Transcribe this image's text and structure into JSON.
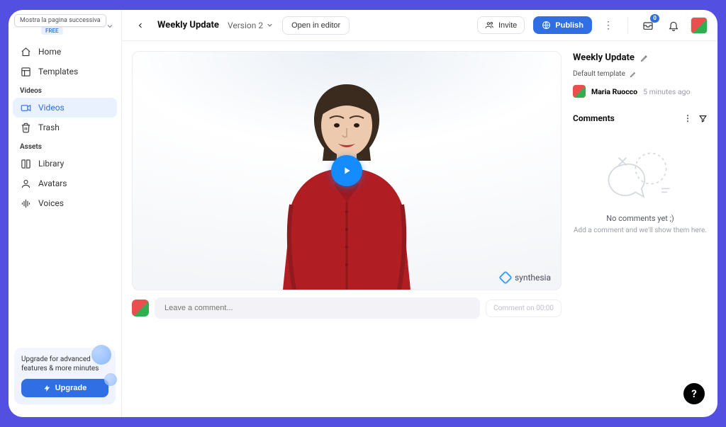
{
  "tooltip": "Mostra la pagina successiva",
  "plan_badge": "FREE",
  "sidebar": {
    "nav": [
      {
        "label": "Home"
      },
      {
        "label": "Templates"
      }
    ],
    "sections": [
      {
        "title": "Videos",
        "items": [
          {
            "label": "Videos",
            "active": true
          },
          {
            "label": "Trash"
          }
        ]
      },
      {
        "title": "Assets",
        "items": [
          {
            "label": "Library"
          },
          {
            "label": "Avatars"
          },
          {
            "label": "Voices"
          }
        ]
      }
    ],
    "upgrade": {
      "text": "Upgrade for advanced features & more minutes",
      "button": "Upgrade"
    }
  },
  "topbar": {
    "title": "Weekly Update",
    "version": "Version 2",
    "open_editor": "Open in editor",
    "invite": "Invite",
    "publish": "Publish",
    "notifications_count": "0"
  },
  "video": {
    "watermark": "synthesia"
  },
  "comment_box": {
    "placeholder": "Leave a comment...",
    "timestamp_button": "Comment on 00:00"
  },
  "right": {
    "title": "Weekly Update",
    "subtitle": "Default template",
    "author": "Maria Ruocco",
    "time": "5 minutes ago",
    "comments_header": "Comments",
    "empty_heading": "No comments yet ;)",
    "empty_sub": "Add a comment and we'll show them here."
  },
  "help": "?"
}
